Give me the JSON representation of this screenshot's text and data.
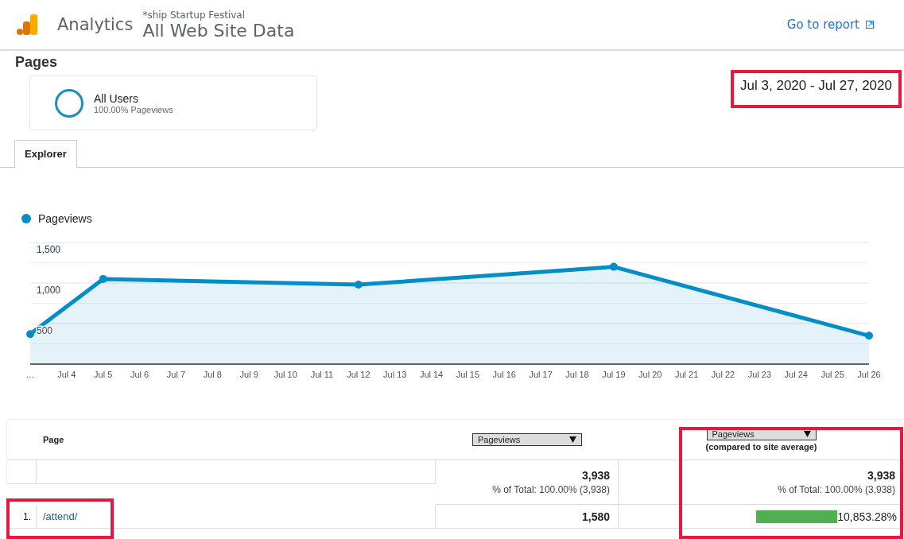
{
  "header": {
    "product": "Analytics",
    "account": "*ship Startup Festival",
    "property": "All Web Site Data",
    "report_link": "Go to report"
  },
  "page_title": "Pages",
  "date_range": "Jul 3, 2020 - Jul 27, 2020",
  "segment": {
    "name": "All Users",
    "detail": "100.00% Pageviews"
  },
  "tabs": [
    {
      "label": "Explorer",
      "selected": true
    }
  ],
  "chart": {
    "chart_data": {
      "type": "area",
      "categories": [
        "…",
        "Jul 4",
        "Jul 5",
        "Jul 6",
        "Jul 7",
        "Jul 8",
        "Jul 9",
        "Jul 10",
        "Jul 11",
        "Jul 12",
        "Jul 13",
        "Jul 14",
        "Jul 15",
        "Jul 16",
        "Jul 17",
        "Jul 18",
        "Jul 19",
        "Jul 20",
        "Jul 21",
        "Jul 22",
        "Jul 23",
        "Jul 24",
        "Jul 25",
        "Jul 26"
      ],
      "series": [
        {
          "name": "Pageviews",
          "color": "#058dc7",
          "values": [
            370,
            null,
            1050,
            null,
            null,
            null,
            null,
            null,
            null,
            980,
            null,
            null,
            null,
            null,
            null,
            null,
            1200,
            null,
            null,
            null,
            null,
            null,
            null,
            350
          ]
        }
      ],
      "ylim": [
        0,
        1500
      ],
      "yticks": [
        {
          "value": 500,
          "label": "500"
        },
        {
          "value": 1000,
          "label": "1,000"
        },
        {
          "value": 1500,
          "label": "1,500"
        }
      ]
    }
  },
  "table": {
    "columns": [
      {
        "label": "Page"
      },
      {
        "metric": "Pageviews"
      },
      {
        "metric": "Pageviews",
        "note": "(compared to site average)"
      }
    ],
    "totals": [
      {
        "value": "3,938",
        "share": "% of Total: 100.00% (3,938)"
      },
      {
        "value": "3,938",
        "share": "% of Total: 100.00% (3,938)"
      }
    ],
    "rows": [
      {
        "rank": "1.",
        "page": "/attend/",
        "pageviews": "1,580",
        "comparison": "10,853.28%",
        "level": 0.6
      }
    ]
  }
}
